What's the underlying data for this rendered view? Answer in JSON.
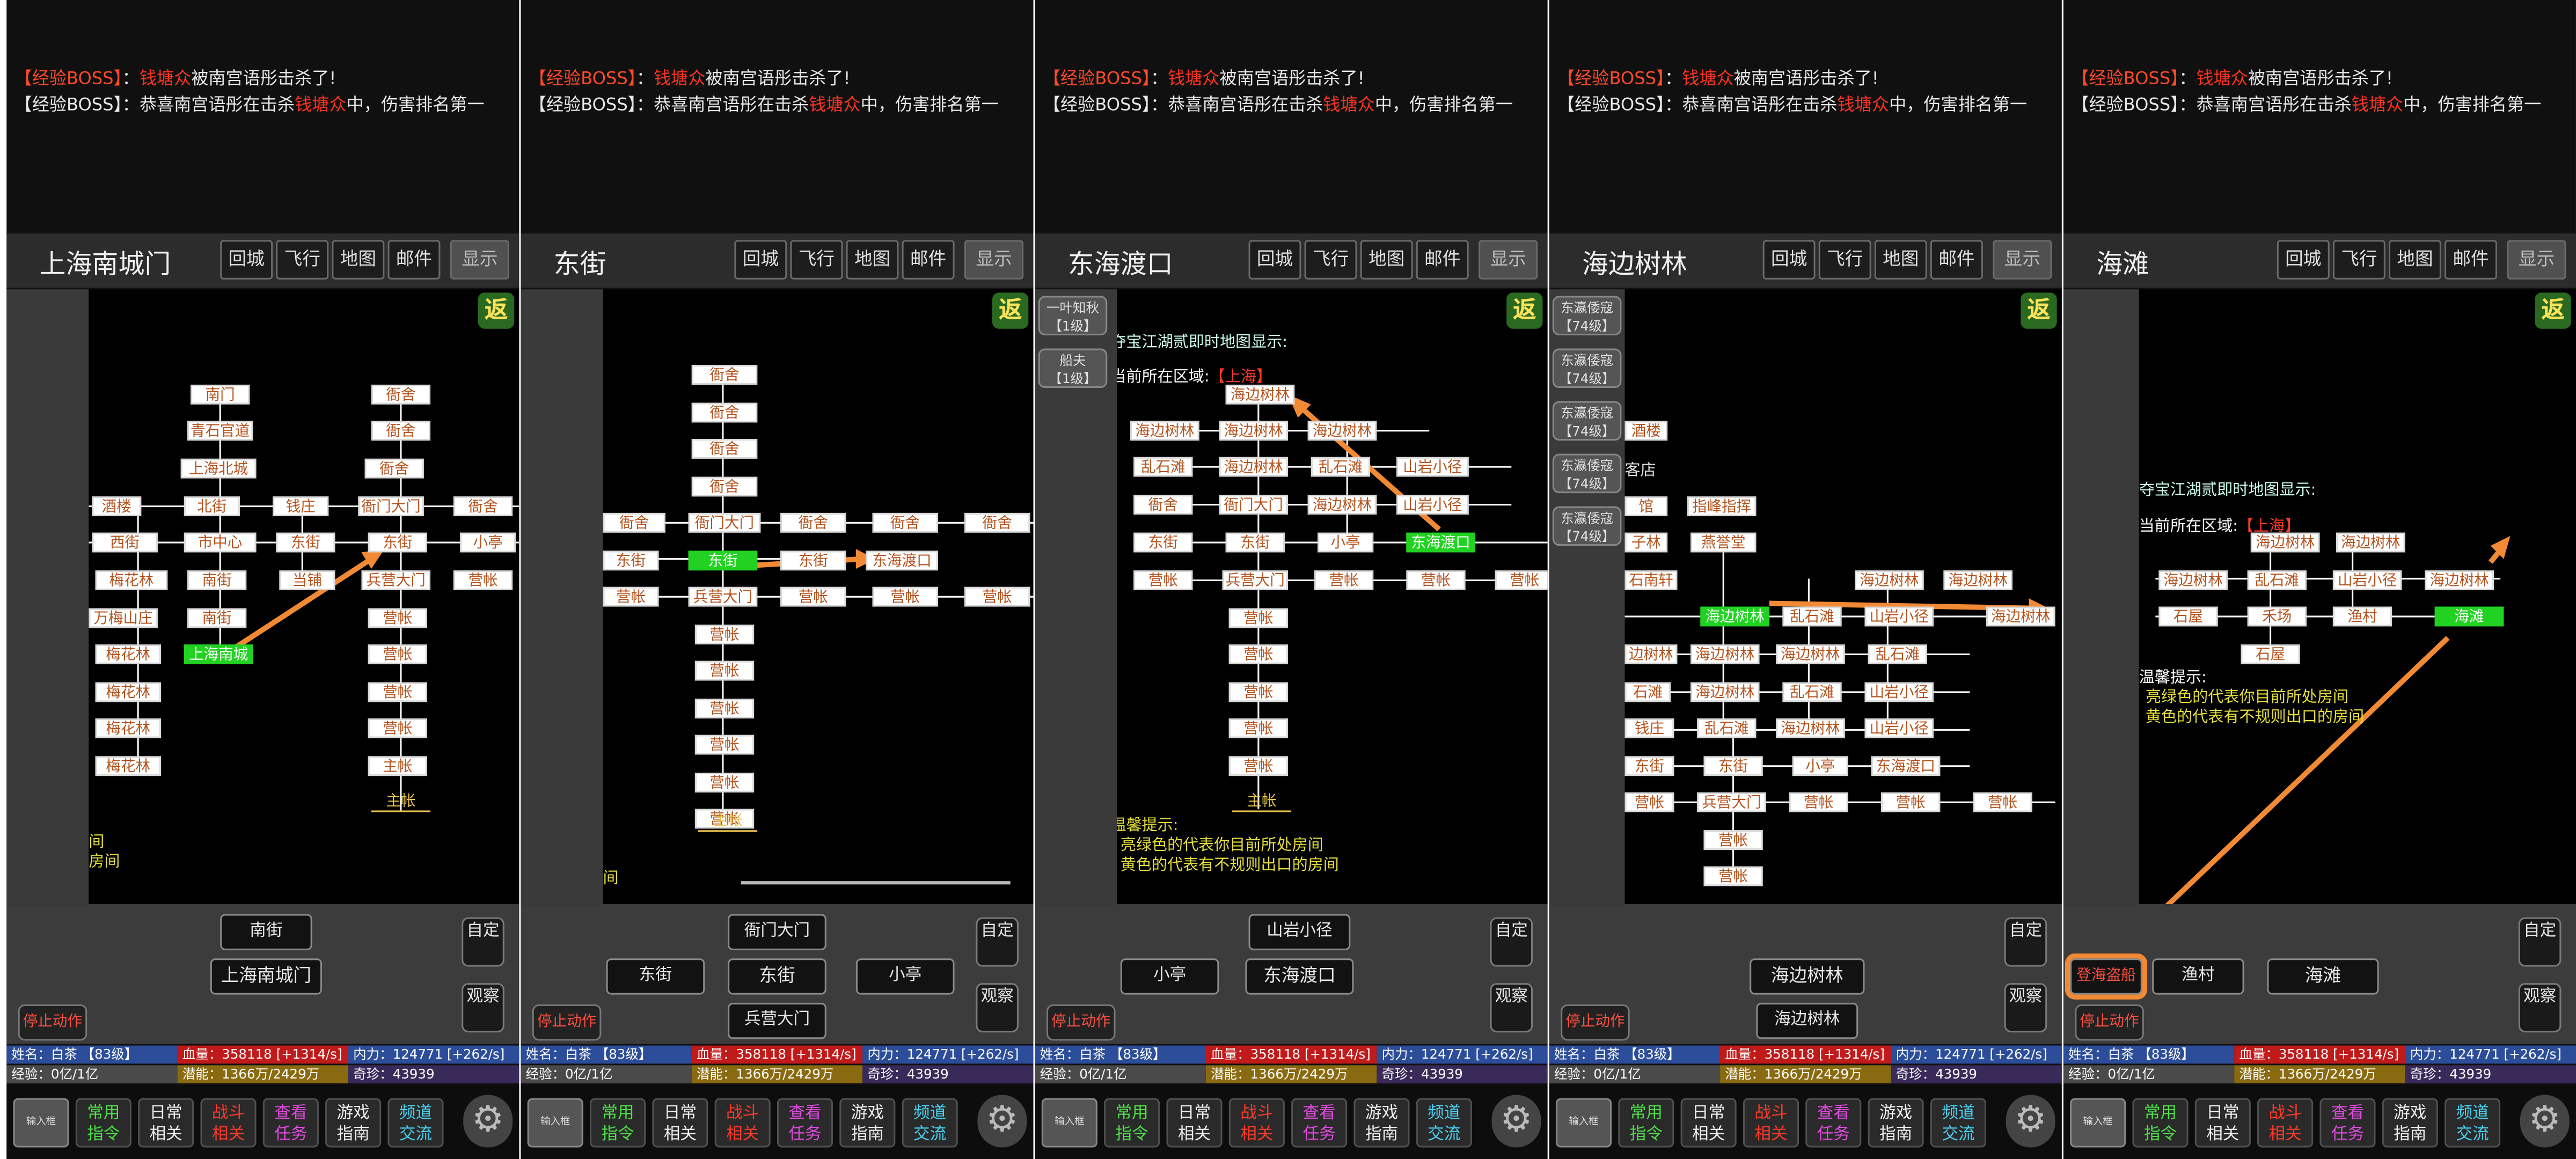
{
  "messages": {
    "line1": {
      "tag": "【经验BOSS】",
      "colon": "：",
      "name": "钱塘众",
      "rest": "被南宫语彤击杀了!"
    },
    "line2": {
      "tag": "【经验BOSS】",
      "colon": "：",
      "pre": "恭喜南宫语彤在击杀",
      "name": "钱塘众",
      "rest": "中，伤害排名第一"
    }
  },
  "header_buttons": [
    "回城",
    "飞行",
    "地图",
    "邮件",
    "显示"
  ],
  "badge": "返",
  "stats": {
    "name": "姓名：白茶 【83级】",
    "hp": "血量：358118 [+1314/s]",
    "mp": "内力：124771 [+262/s]",
    "exp": "经验：0亿/1亿",
    "potential": "潜能：1366万/2429万",
    "qizhen": "奇珍：43939"
  },
  "right_buttons": {
    "custom": "自定",
    "observe": "观察"
  },
  "stop_action": "停止动作",
  "footer": {
    "keyboard": "输入框",
    "buttons": [
      {
        "line1": "常用",
        "line2": "指令",
        "color": "#4fe04a"
      },
      {
        "line1": "日常",
        "line2": "相关",
        "color": "#f0f0f0"
      },
      {
        "line1": "战斗",
        "line2": "相关",
        "color": "#ff3a2a"
      },
      {
        "line1": "查看",
        "line2": "任务",
        "color": "#e04ae0"
      },
      {
        "line1": "游戏",
        "line2": "指南",
        "color": "#f0f0f0"
      },
      {
        "line1": "频道",
        "line2": "交流",
        "color": "#4ad0f0"
      }
    ]
  },
  "panels": [
    {
      "title": "上海南城门",
      "map_nodes": [
        "南门",
        "衙舍",
        "青石官道",
        "衙舍",
        "上海北城",
        "衙舍",
        "酒楼",
        "北街",
        "钱庄",
        "衙门大门",
        "衙舍",
        "西街",
        "市中心",
        "东街",
        "东街",
        "小亭",
        "梅花林",
        "南街",
        "当铺",
        "兵营大门",
        "营帐",
        "万梅山庄",
        "南街",
        "营帐",
        "梅花林",
        "上海南城",
        "营帐",
        "梅花林",
        "营帐",
        "梅花林",
        "营帐",
        "梅花林",
        "主帐",
        "主帐"
      ],
      "map_texts": [
        "间",
        "房间"
      ],
      "exits": [
        "南街",
        "上海南城门"
      ]
    },
    {
      "title": "东街",
      "map_nodes": [
        "衙舍",
        "衙舍",
        "衙舍",
        "衙舍",
        "衙舍",
        "衙门大门",
        "衙舍",
        "衙舍",
        "衙舍",
        "东街",
        "东街",
        "东街",
        "东海渡口",
        "营帐",
        "兵营大门",
        "营帐",
        "营帐",
        "营帐",
        "营帐",
        "营帐",
        "营帐",
        "营帐",
        "营帐",
        "营帐",
        "主帐",
        "主帐"
      ],
      "map_texts": [
        "间"
      ],
      "exits": [
        "衙门大门",
        "东街",
        "东街",
        "小亭",
        "兵营大门"
      ]
    },
    {
      "title": "东海渡口",
      "side_buttons": [
        {
          "line1": "一叶知秋",
          "line2": "【1级】"
        },
        {
          "line1": "船夫",
          "line2": "【1级】"
        }
      ],
      "map_header": "夺宝江湖贰即时地图显示:",
      "area_label": "当前所在区域:",
      "area_name": "【上海】",
      "map_nodes": [
        "海边树林",
        "海边树林",
        "海边树林",
        "海边树林",
        "乱石滩",
        "海边树林",
        "乱石滩",
        "山岩小径",
        "衙舍",
        "衙门大门",
        "海边树林",
        "山岩小径",
        "东街",
        "东街",
        "小亭",
        "东海渡口",
        "营帐",
        "兵营大门",
        "营帐",
        "营帐",
        "营帐",
        "营帐",
        "营帐",
        "营帐",
        "营帐",
        "营帐",
        "主帐",
        "主帐"
      ],
      "tips_title": "温馨提示:",
      "tips": [
        "亮绿色的代表你目前所处房间",
        "黄色的代表有不规则出口的房间"
      ],
      "exits": [
        "山岩小径",
        "小亭",
        "东海渡口"
      ]
    },
    {
      "title": "海边树林",
      "side_buttons": [
        {
          "line1": "东瀛倭寇",
          "line2": "【74级】"
        },
        {
          "line1": "东瀛倭寇",
          "line2": "【74级】"
        },
        {
          "line1": "东瀛倭寇",
          "line2": "【74级】"
        },
        {
          "line1": "东瀛倭寇",
          "line2": "【74级】"
        },
        {
          "line1": "东瀛倭寇",
          "line2": "【74级】"
        }
      ],
      "map_nodes": [
        "酒楼",
        "客店",
        "馆",
        "指峰指挥",
        "子林",
        "燕誉堂",
        "石南轩",
        "海边树林",
        "海边树林",
        "海边树林",
        "乱石滩",
        "山岩小径",
        "海边树林",
        "边树林",
        "海边树林",
        "海边树林",
        "乱石滩",
        "石滩",
        "海边树林",
        "乱石滩",
        "山岩小径",
        "钱庄",
        "乱石滩",
        "海边树林",
        "山岩小径",
        "东街",
        "东街",
        "小亭",
        "东海渡口",
        "营帐",
        "兵营大门",
        "营帐",
        "营帐",
        "营帐",
        "营帐",
        "营帐"
      ],
      "exits": [
        "海边树林",
        "海边树林"
      ]
    },
    {
      "title": "海滩",
      "map_header": "夺宝江湖贰即时地图显示:",
      "area_label": "当前所在区域:",
      "area_name": "【上海】",
      "map_nodes": [
        "海边树林",
        "海边树林",
        "海边树林",
        "乱石滩",
        "山岩小径",
        "海边树林",
        "石屋",
        "禾场",
        "渔村",
        "海滩",
        "石屋"
      ],
      "tips_title": "温馨提示:",
      "tips": [
        "亮绿色的代表你目前所处房间",
        "黄色的代表有不规则出口的房间"
      ],
      "exits": [
        "登海盗船",
        "渔村",
        "海滩"
      ]
    }
  ]
}
